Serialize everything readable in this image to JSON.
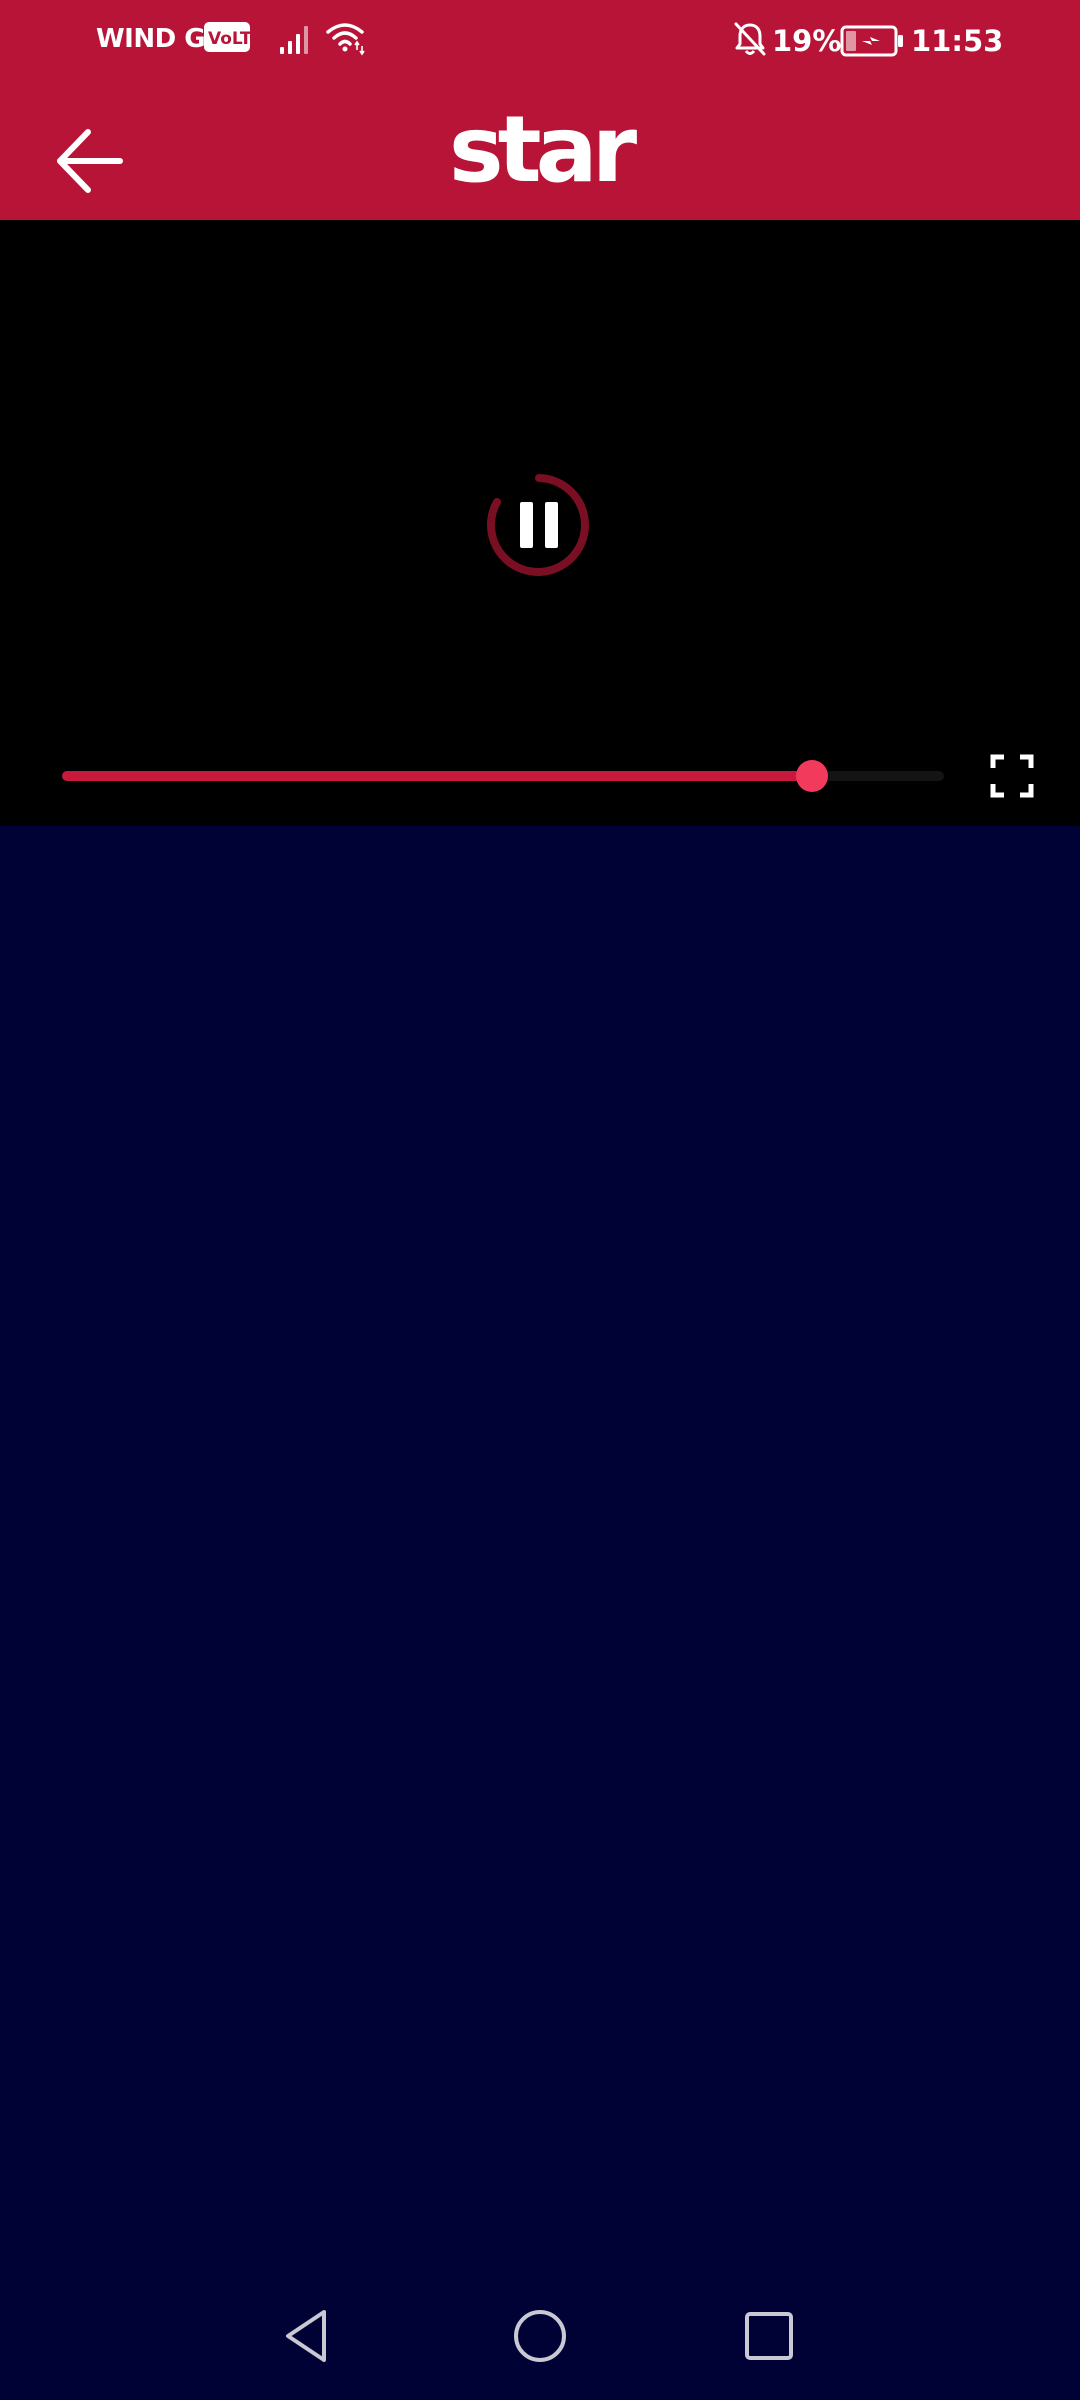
{
  "status_bar": {
    "carrier": "WIND GR",
    "volte_badge": "VoLTE",
    "battery_percent": "19%",
    "time": "11:53",
    "icons": [
      "signal-icon",
      "wifi-icon",
      "bell-off-icon",
      "battery-charging-icon"
    ]
  },
  "header": {
    "logo_text": "star",
    "back_icon": "arrow-left-icon"
  },
  "player": {
    "state_icon": "pause-icon",
    "progress_fraction": 0.85,
    "fullscreen_icon": "fullscreen-icon"
  },
  "nav_bar": {
    "icons": [
      "back-triangle-icon",
      "home-circle-icon",
      "recents-square-icon"
    ]
  },
  "colors": {
    "brand_red": "#b81437",
    "seek_fill": "#c8183c",
    "seek_thumb": "#f23a5c",
    "player_bg": "#000000",
    "page_bg": "#000236"
  }
}
